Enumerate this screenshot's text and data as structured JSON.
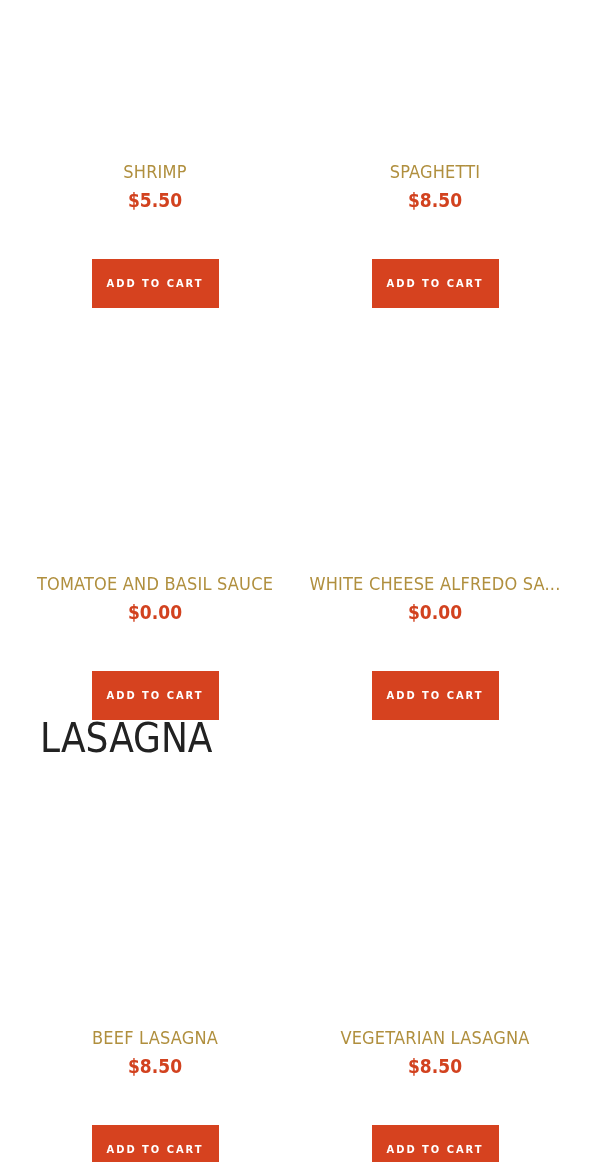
{
  "sections": [
    {
      "products": [
        {
          "name": "SHRIMP",
          "price": "$5.50",
          "button": "ADD TO CART"
        },
        {
          "name": "SPAGHETTI",
          "price": "$8.50",
          "button": "ADD TO CART"
        },
        {
          "name": "TOMATOE AND BASIL SAUCE",
          "price": "$0.00",
          "button": "ADD TO CART"
        },
        {
          "name": "WHITE CHEESE ALFREDO SA...",
          "price": "$0.00",
          "button": "ADD TO CART"
        }
      ]
    },
    {
      "heading": "LASAGNA",
      "products": [
        {
          "name": "BEEF LASAGNA",
          "price": "$8.50",
          "button": "ADD TO CART"
        },
        {
          "name": "VEGETARIAN LASAGNA",
          "price": "$8.50",
          "button": "ADD TO CART"
        }
      ]
    }
  ]
}
